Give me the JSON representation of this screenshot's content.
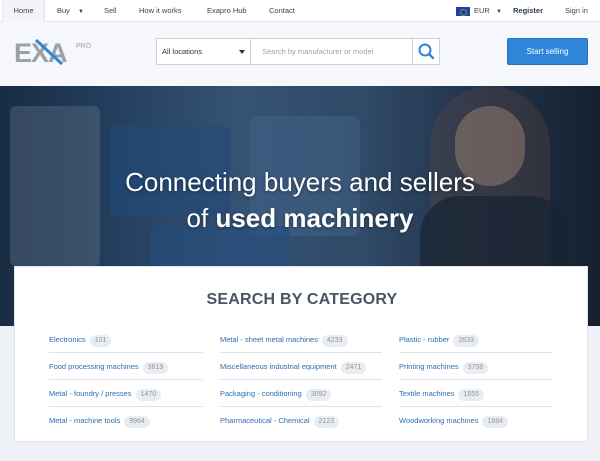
{
  "topnav": {
    "home": "Home",
    "buy": "Buy",
    "sell": "Sell",
    "how": "How it works",
    "hub": "Exapro Hub",
    "contact": "Contact",
    "currency": "EUR",
    "register": "Register",
    "signin": "Sign in"
  },
  "header": {
    "logo_text": "EXA",
    "logo_sub": "PRO",
    "location": "All locations",
    "search_placeholder": "Search by manufacturer or model",
    "sell_button": "Start selling"
  },
  "hero": {
    "line1": "Connecting buyers and sellers",
    "line2_prefix": "of",
    "line2_bold": "used machinery"
  },
  "categories": {
    "title": "SEARCH BY CATEGORY",
    "columns": [
      [
        {
          "label": "Electronics",
          "count": "101"
        },
        {
          "label": "Food processing machines",
          "count": "3619"
        },
        {
          "label": "Metal - foundry / presses",
          "count": "1470"
        },
        {
          "label": "Metal - machine tools",
          "count": "9964"
        }
      ],
      [
        {
          "label": "Metal - sheet metal machines",
          "count": "4233"
        },
        {
          "label": "Miscellaneous industrial equipment",
          "count": "2471"
        },
        {
          "label": "Packaging - conditioning",
          "count": "3092"
        },
        {
          "label": "Pharmaceutical - Chemical",
          "count": "2123"
        }
      ],
      [
        {
          "label": "Plastic - rubber",
          "count": "2633"
        },
        {
          "label": "Printing machines",
          "count": "3758"
        },
        {
          "label": "Textile machines",
          "count": "1655"
        },
        {
          "label": "Woodworking machines",
          "count": "1884"
        }
      ]
    ]
  },
  "colors": {
    "accent": "#2f86d9",
    "link": "#2a6fb0"
  }
}
